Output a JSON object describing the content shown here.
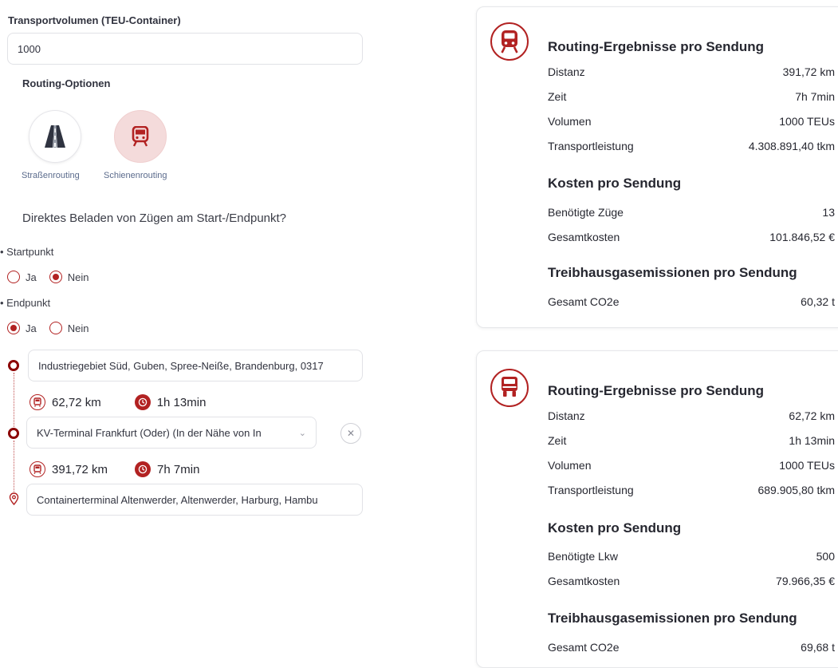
{
  "form": {
    "volume_label": "Transportvolumen (TEU-Container)",
    "volume_value": "1000",
    "routing_options_title": "Routing-Optionen",
    "options": [
      {
        "label": "Straßenrouting",
        "icon": "road-icon",
        "selected": false
      },
      {
        "label": "Schienenrouting",
        "icon": "train-icon",
        "selected": true
      }
    ],
    "question": "Direktes Beladen von Zügen am Start-/Endpunkt?",
    "startpunkt": {
      "label": "• Startpunkt",
      "options": [
        {
          "label": "Ja",
          "checked": false
        },
        {
          "label": "Nein",
          "checked": true
        }
      ]
    },
    "endpunkt": {
      "label": "• Endpunkt",
      "options": [
        {
          "label": "Ja",
          "checked": true
        },
        {
          "label": "Nein",
          "checked": false
        }
      ]
    }
  },
  "route": {
    "stops": [
      {
        "value": "Industriegebiet Süd, Guben, Spree-Neiße, Brandenburg, 0317",
        "marker": "circle-marker"
      },
      {
        "value": "KV-Terminal Frankfurt (Oder) (In der Nähe von In",
        "marker": "circle-marker"
      },
      {
        "value": "Containerterminal Altenwerder, Altenwerder, Harburg, Hambu",
        "marker": "location-pin-icon"
      }
    ],
    "legs": [
      {
        "distance": "62,72 km",
        "time": "1h 13min",
        "mode_icon": "truck-icon"
      },
      {
        "distance": "391,72 km",
        "time": "7h 7min",
        "mode_icon": "train-icon"
      }
    ]
  },
  "cards": [
    {
      "icon": "train-icon",
      "title": "Routing-Ergebnisse pro Sendung",
      "routing": [
        {
          "label": "Distanz",
          "value": "391,72 km"
        },
        {
          "label": "Zeit",
          "value": "7h 7min"
        },
        {
          "label": "Volumen",
          "value": "1000 TEUs"
        },
        {
          "label": "Transportleistung",
          "value": "4.308.891,40 tkm"
        }
      ],
      "cost_title": "Kosten pro Sendung",
      "costs": [
        {
          "label": "Benötigte Züge",
          "value": "13"
        },
        {
          "label": "Gesamtkosten",
          "value": "101.846,52 €"
        }
      ],
      "emission_title": "Treibhausgasemissionen pro Sendung",
      "emissions": [
        {
          "label": "Gesamt CO2e",
          "value": "60,32 t"
        }
      ]
    },
    {
      "icon": "truck-icon",
      "title": "Routing-Ergebnisse pro Sendung",
      "routing": [
        {
          "label": "Distanz",
          "value": "62,72 km"
        },
        {
          "label": "Zeit",
          "value": "1h 13min"
        },
        {
          "label": "Volumen",
          "value": "1000 TEUs"
        },
        {
          "label": "Transportleistung",
          "value": "689.905,80 tkm"
        }
      ],
      "cost_title": "Kosten pro Sendung",
      "costs": [
        {
          "label": "Benötigte Lkw",
          "value": "500"
        },
        {
          "label": "Gesamtkosten",
          "value": "79.966,35 €"
        }
      ],
      "emission_title": "Treibhausgasemissionen pro Sendung",
      "emissions": [
        {
          "label": "Gesamt CO2e",
          "value": "69,68 t"
        }
      ]
    }
  ],
  "colors": {
    "accent": "#b22222",
    "accent_dark": "#8b0000",
    "selected_bg": "#f4dbdb"
  }
}
